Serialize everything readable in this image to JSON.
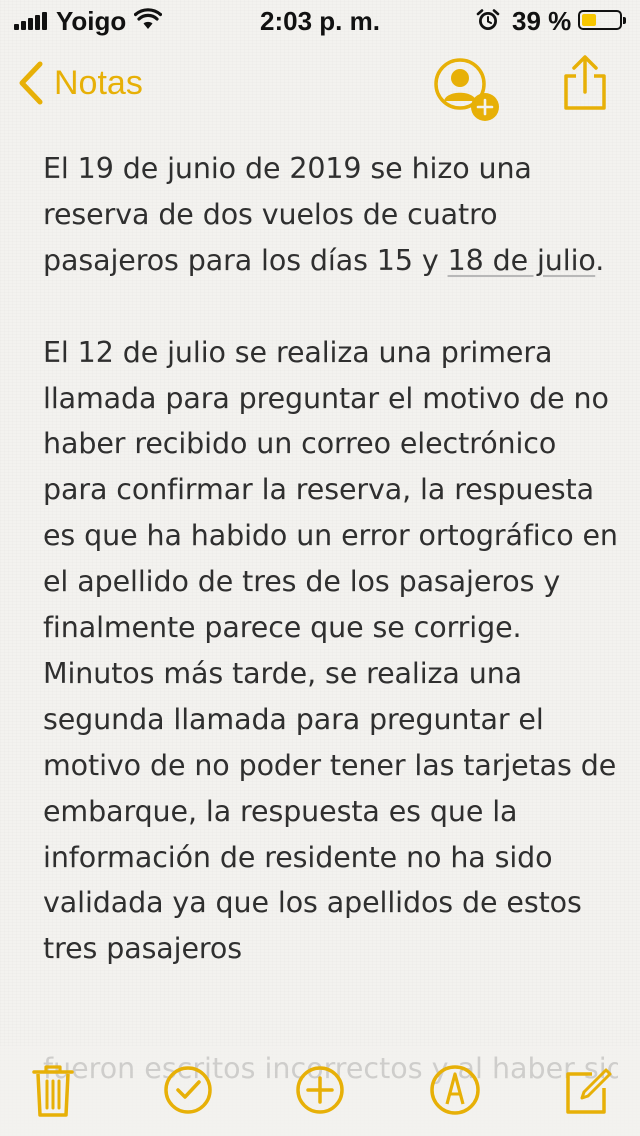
{
  "status_bar": {
    "carrier": "Yoigo",
    "time": "2:03 p. m.",
    "battery_percent_label": "39 %",
    "battery_level": 0.39
  },
  "nav": {
    "back_label": "Notas",
    "accent_color": "#e7b007"
  },
  "note": {
    "p1_before_link": "El 19 de junio de 2019 se hizo una reserva de dos vuelos de cuatro pasajeros para los días 15 y ",
    "p1_link": "18 de julio",
    "p1_after_link": ".",
    "p2": "El 12 de julio se realiza una primera llamada para preguntar el motivo de no haber recibido un correo electrónico para confirmar la reserva, la respuesta es que ha habido un error ortográfico en el apellido de tres de los pasajeros y finalmente parece que se corrige. Minutos más tarde, se realiza una segunda llamada para preguntar el motivo de no poder tener las tarjetas de embarque, la respuesta es que la información de residente no ha sido validada ya que los apellidos de estos tres pasajeros",
    "p2_hidden_tail": "fueron escritos incorrectos y al haber sido estos deletreados, por tanto, se"
  },
  "toolbar": {
    "icons": [
      "trash-icon",
      "checklist-icon",
      "add-icon",
      "markup-icon",
      "compose-icon"
    ]
  }
}
